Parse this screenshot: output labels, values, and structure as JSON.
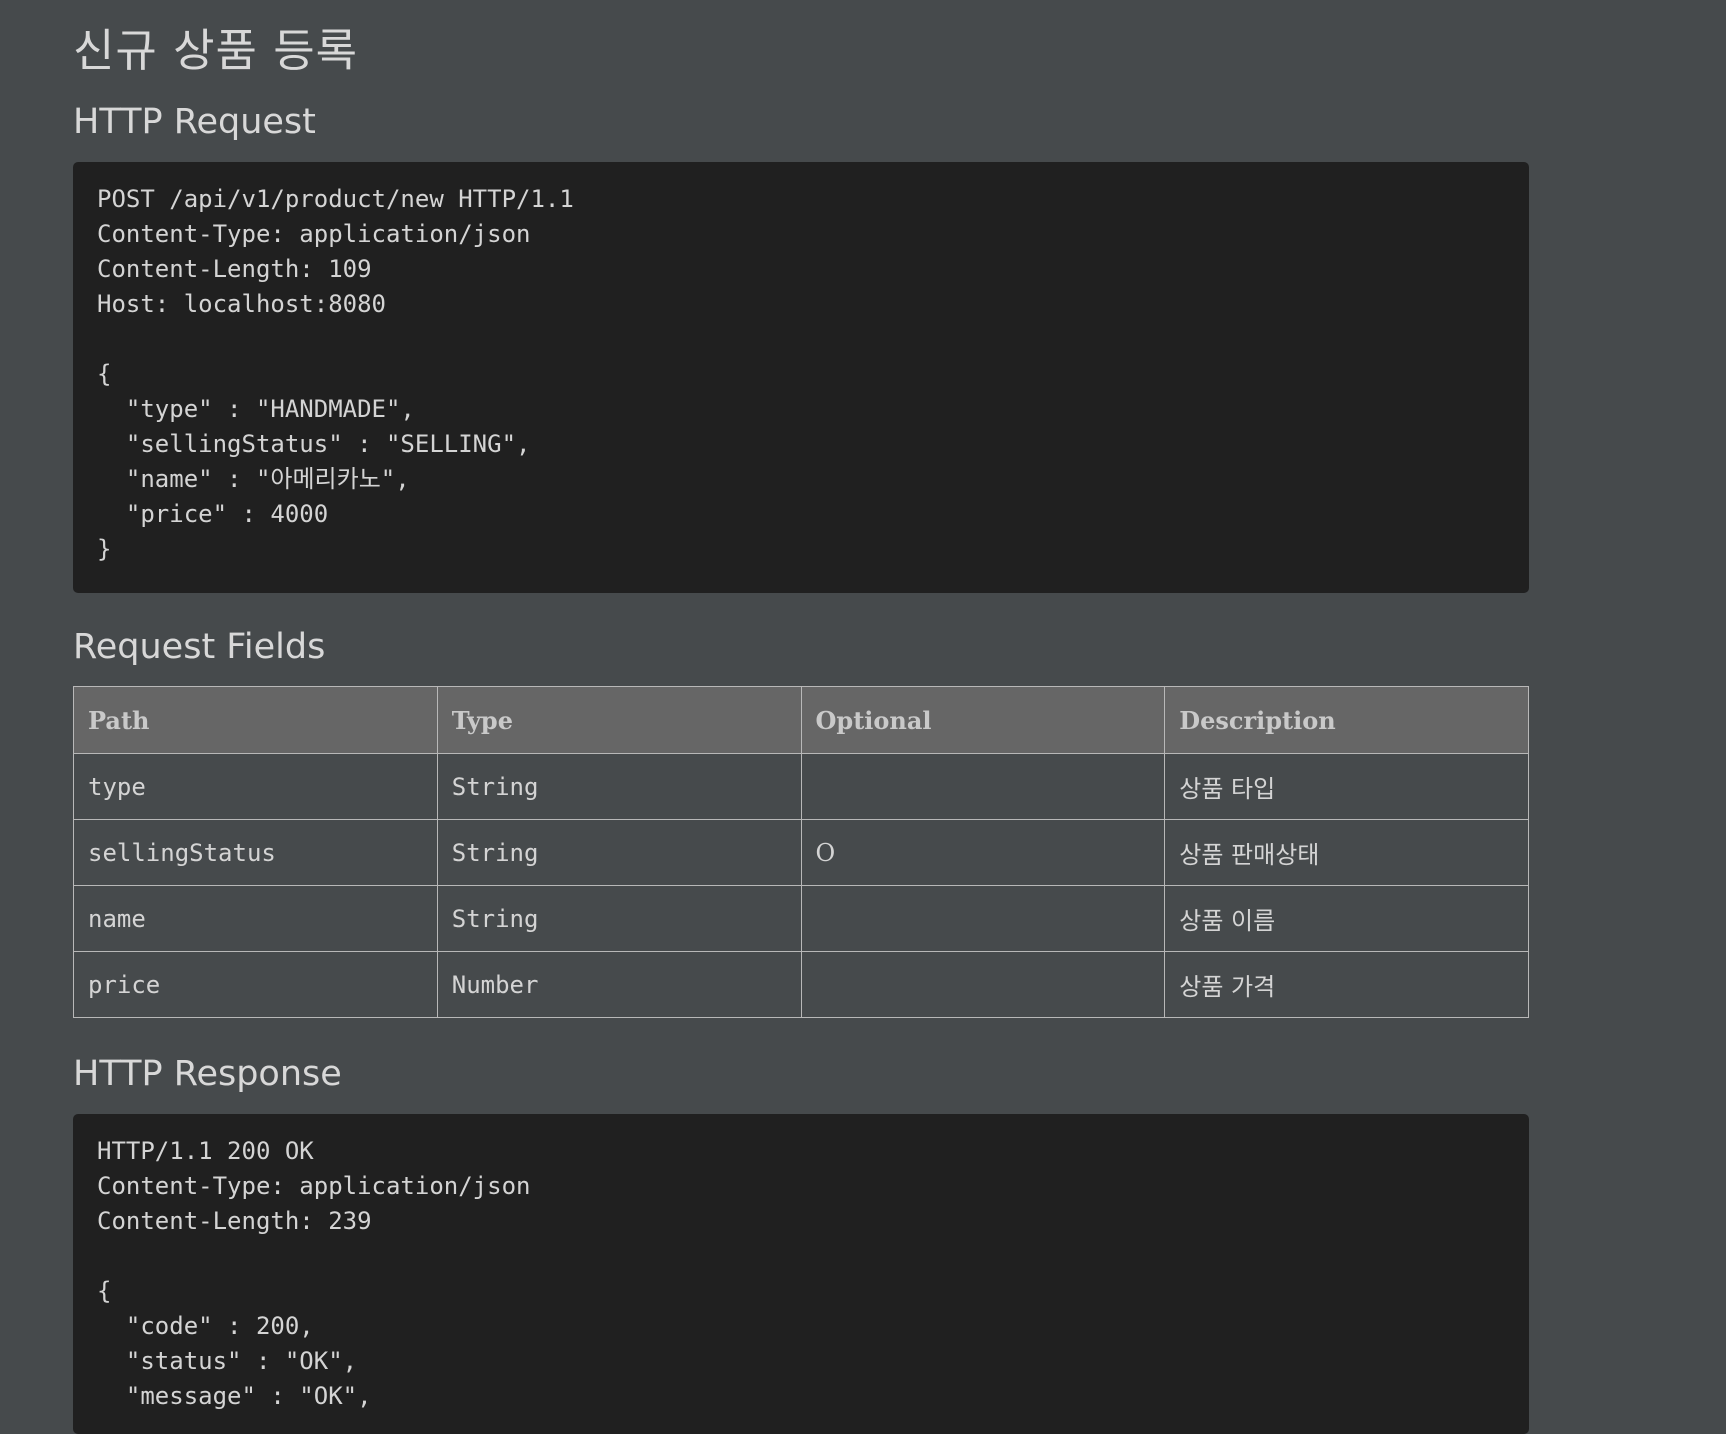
{
  "page": {
    "title": "신규 상품 등록"
  },
  "request": {
    "heading": "HTTP Request",
    "code": "POST /api/v1/product/new HTTP/1.1\nContent-Type: application/json\nContent-Length: 109\nHost: localhost:8080\n\n{\n  \"type\" : \"HANDMADE\",\n  \"sellingStatus\" : \"SELLING\",\n  \"name\" : \"아메리카노\",\n  \"price\" : 4000\n}"
  },
  "request_fields": {
    "heading": "Request Fields",
    "columns": [
      "Path",
      "Type",
      "Optional",
      "Description"
    ],
    "rows": [
      {
        "path": "type",
        "type": "String",
        "optional": "",
        "description": "상품 타입"
      },
      {
        "path": "sellingStatus",
        "type": "String",
        "optional": "O",
        "description": "상품 판매상태"
      },
      {
        "path": "name",
        "type": "String",
        "optional": "",
        "description": "상품 이름"
      },
      {
        "path": "price",
        "type": "Number",
        "optional": "",
        "description": "상품 가격"
      }
    ]
  },
  "response": {
    "heading": "HTTP Response",
    "code": "HTTP/1.1 200 OK\nContent-Type: application/json\nContent-Length: 239\n\n{\n  \"code\" : 200,\n  \"status\" : \"OK\",\n  \"message\" : \"OK\","
  },
  "colors": {
    "page_background": "#464a4c",
    "code_background": "#202020",
    "table_header_background": "#666666",
    "table_border": "#b8b8b8",
    "text": "#d6d6d6"
  }
}
